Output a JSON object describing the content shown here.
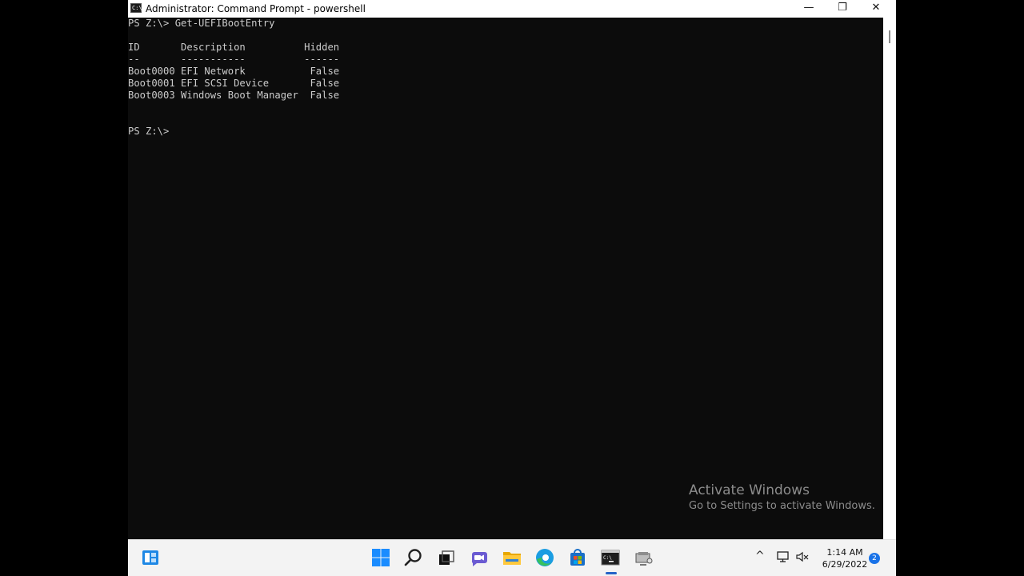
{
  "window": {
    "title": "Administrator: Command Prompt - powershell",
    "app_icon_text": "C:\\",
    "minimize_glyph": "—",
    "restore_glyph": "❐",
    "close_glyph": "✕"
  },
  "console": {
    "lines": [
      "PS Z:\\> Get-UEFIBootEntry",
      "",
      "ID       Description          Hidden",
      "--       -----------          ------",
      "Boot0000 EFI Network           False",
      "Boot0001 EFI SCSI Device       False",
      "Boot0003 Windows Boot Manager  False",
      "",
      "",
      "PS Z:\\> "
    ]
  },
  "watermark": {
    "title": "Activate Windows",
    "subtitle": "Go to Settings to activate Windows."
  },
  "taskbar": {
    "apps": [
      "widgets-icon",
      "start-icon",
      "search-icon",
      "task-view-icon",
      "chat-icon",
      "file-explorer-icon",
      "edge-icon",
      "store-icon",
      "command-prompt-icon",
      "app-icon"
    ],
    "active_app": "command-prompt-icon",
    "tray": {
      "chevron": "^",
      "time": "1:14 AM",
      "date": "6/29/2022",
      "notification_count": "2"
    }
  },
  "colors": {
    "console_bg": "#0c0c0c",
    "console_fg": "#cccccc",
    "accent": "#1a73e8"
  }
}
